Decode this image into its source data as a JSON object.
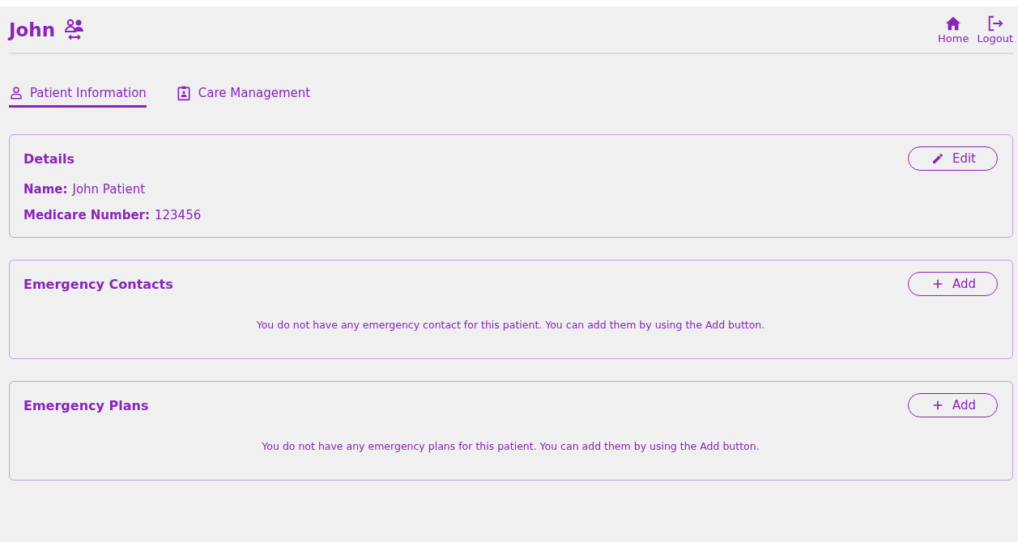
{
  "header": {
    "title": "John",
    "nav": [
      {
        "kind": "home",
        "label": "Home"
      },
      {
        "kind": "logout",
        "label": "Logout"
      }
    ]
  },
  "tabs": [
    {
      "kind": "person",
      "label": "Patient Information",
      "selected": true
    },
    {
      "kind": "clipboard",
      "label": "Care Management",
      "selected": false
    }
  ],
  "sections": [
    {
      "title": "Details",
      "button": {
        "kind": "edit",
        "label": "Edit"
      },
      "fields": [
        {
          "label": "Name:",
          "value": "John Patient"
        },
        {
          "label": "Medicare Number:",
          "value": "123456"
        }
      ]
    },
    {
      "title": "Emergency Contacts",
      "button": {
        "kind": "add",
        "label": "Add"
      },
      "empty_message": "You do not have any emergency contact for this patient. You can add them by using the Add button."
    },
    {
      "title": "Emergency Plans",
      "button": {
        "kind": "add",
        "label": "Add"
      },
      "empty_message": "You do not have any emergency plans for this patient. You can add them by using the Add button."
    }
  ]
}
